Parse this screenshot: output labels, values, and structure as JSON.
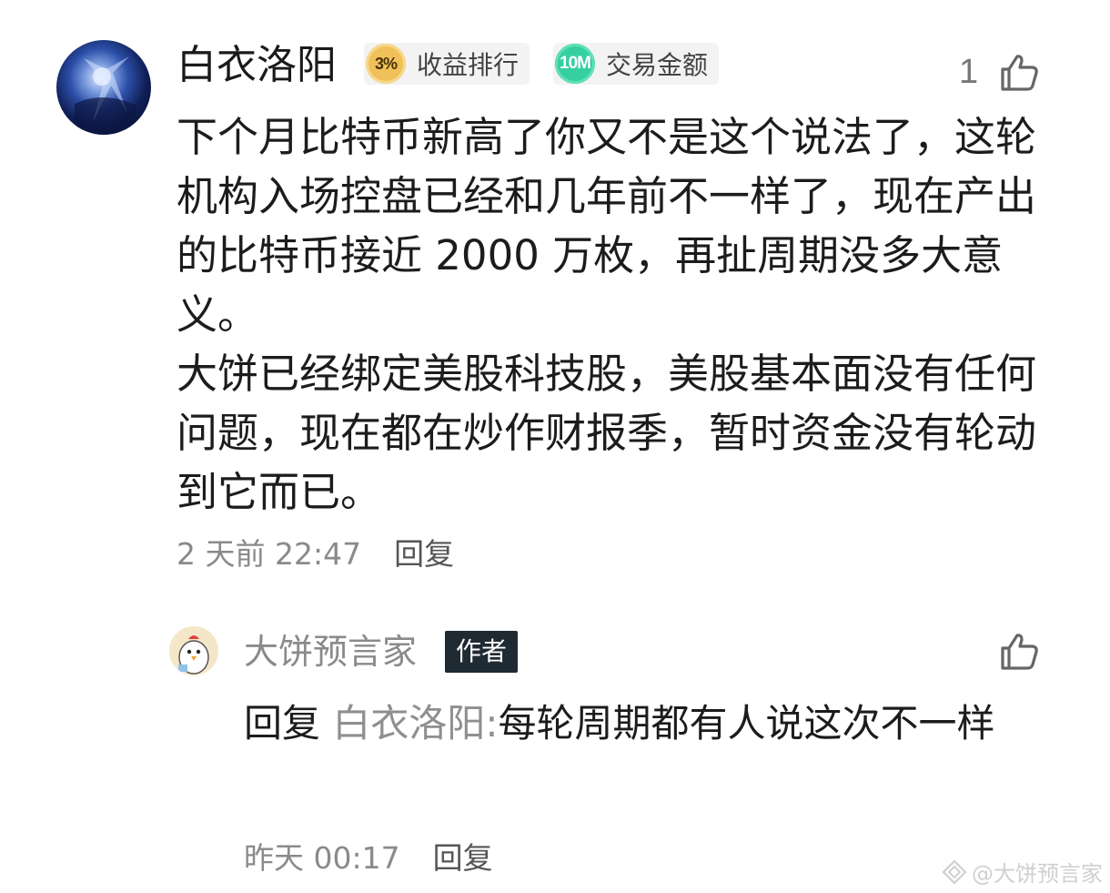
{
  "comment": {
    "username": "白衣洛阳",
    "badges": [
      {
        "icon_text": "3%",
        "label": "收益排行",
        "color": "#f0c15a"
      },
      {
        "icon_text": "10M",
        "label": "交易金额",
        "color": "#35cfa0"
      }
    ],
    "like_count": "1",
    "paragraphs": [
      "下个月比特币新高了你又不是这个说法了，这轮机构入场控盘已经和几年前不一样了，现在产出的比特币接近 2000 万枚，再扯周期没多大意义。",
      "大饼已经绑定美股科技股，美股基本面没有任何问题，现在都在炒作财报季，暂时资金没有轮动到它而已。"
    ],
    "timestamp": "2 天前 22:47",
    "reply_label": "回复"
  },
  "reply": {
    "username": "大饼预言家",
    "author_tag": "作者",
    "prefix": "回复",
    "target": "白衣洛阳:",
    "text": "每轮周期都有人说这次不一样",
    "timestamp": "昨天 00:17",
    "reply_label": "回复"
  },
  "watermark": "@大饼预言家",
  "icons": {
    "like": "thumbs-up-icon",
    "watermark": "diamond-logo-icon"
  }
}
